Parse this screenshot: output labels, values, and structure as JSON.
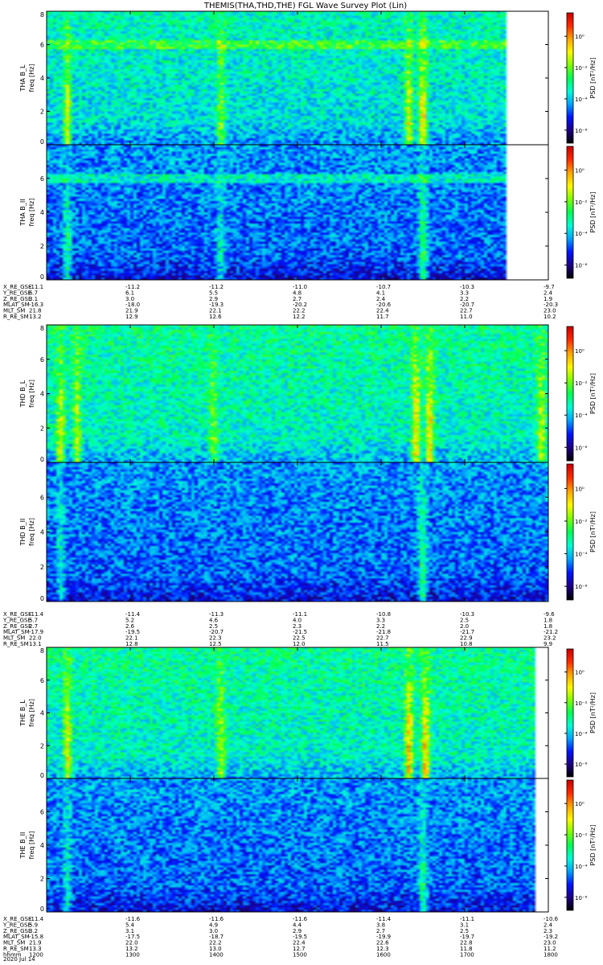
{
  "title": "THEMIS(THA,THD,THE) FGL Wave Survey Plot (Lin)",
  "date_label": "2020 Jul 14",
  "time_row_label": "hhmm",
  "time_ticks": [
    "1200",
    "1300",
    "1400",
    "1500",
    "1600",
    "1700",
    "1800"
  ],
  "chart_data": {
    "type": "heatmap",
    "x": {
      "label": "hhmm",
      "ticks": [
        "1200",
        "1300",
        "1400",
        "1500",
        "1600",
        "1700",
        "1800"
      ],
      "range": [
        "1200",
        "1800"
      ]
    },
    "y": {
      "ticks": [
        "0",
        "2",
        "4",
        "6",
        "8"
      ],
      "range": [
        0,
        8
      ]
    },
    "colorbar": {
      "label": "PSD [nT²/Hz]",
      "ticks": [
        "10⁰",
        "10⁻²",
        "10⁻⁴",
        "10⁻⁶"
      ],
      "colors": [
        "#000000",
        "#1c0086",
        "#0013ff",
        "#00a4ff",
        "#00ffd4",
        "#00ff52",
        "#7fff00",
        "#fff700",
        "#ffa300",
        "#ff2a00",
        "#c80000"
      ]
    },
    "panels": [
      {
        "probe": "THA",
        "component": "B_L",
        "ylabel_probe": "THA B_L",
        "ylabel_unit": "freq [Hz]",
        "data_end_hhmm": "1730",
        "base_level": 0.42,
        "line_freq": 6.0,
        "bursts": [
          {
            "hhmm": "1215",
            "intensity": 0.35
          },
          {
            "hhmm": "1405",
            "intensity": 0.3
          },
          {
            "hhmm": "1620",
            "intensity": 0.4
          },
          {
            "hhmm": "1630",
            "intensity": 0.5
          }
        ]
      },
      {
        "probe": "THA",
        "component": "B_II",
        "ylabel_probe": "THA B_II",
        "ylabel_unit": "freq [Hz]",
        "data_end_hhmm": "1730",
        "base_level": 0.3,
        "line_freq": 6.0,
        "bursts": [
          {
            "hhmm": "1215",
            "intensity": 0.25
          },
          {
            "hhmm": "1405",
            "intensity": 0.2
          },
          {
            "hhmm": "1630",
            "intensity": 0.35
          }
        ]
      },
      {
        "probe": "THD",
        "component": "B_L",
        "ylabel_probe": "THD B_L",
        "ylabel_unit": "freq [Hz]",
        "data_end_hhmm": "1800",
        "base_level": 0.45,
        "line_freq": null,
        "bursts": [
          {
            "hhmm": "1210",
            "intensity": 0.35
          },
          {
            "hhmm": "1222",
            "intensity": 0.3
          },
          {
            "hhmm": "1400",
            "intensity": 0.25
          },
          {
            "hhmm": "1625",
            "intensity": 0.45
          },
          {
            "hhmm": "1635",
            "intensity": 0.45
          },
          {
            "hhmm": "1755",
            "intensity": 0.35
          }
        ]
      },
      {
        "probe": "THD",
        "component": "B_II",
        "ylabel_probe": "THD B_II",
        "ylabel_unit": "freq [Hz]",
        "data_end_hhmm": "1800",
        "base_level": 0.3,
        "line_freq": null,
        "bursts": [
          {
            "hhmm": "1210",
            "intensity": 0.2
          },
          {
            "hhmm": "1630",
            "intensity": 0.35
          }
        ]
      },
      {
        "probe": "THE",
        "component": "B_L",
        "ylabel_probe": "THE B_L",
        "ylabel_unit": "freq [Hz]",
        "data_end_hhmm": "1750",
        "base_level": 0.45,
        "line_freq": null,
        "bursts": [
          {
            "hhmm": "1215",
            "intensity": 0.35
          },
          {
            "hhmm": "1405",
            "intensity": 0.3
          },
          {
            "hhmm": "1620",
            "intensity": 0.45
          },
          {
            "hhmm": "1632",
            "intensity": 0.5
          }
        ]
      },
      {
        "probe": "THE",
        "component": "B_II",
        "ylabel_probe": "THE B_II",
        "ylabel_unit": "freq [Hz]",
        "data_end_hhmm": "1750",
        "base_level": 0.3,
        "line_freq": null,
        "bursts": [
          {
            "hhmm": "1215",
            "intensity": 0.2
          },
          {
            "hhmm": "1630",
            "intensity": 0.3
          }
        ]
      }
    ]
  },
  "ephemeris": [
    {
      "probe": "THA",
      "rows": [
        {
          "label": "X_RE_GSE",
          "values": [
            "-11.1",
            "-11.2",
            "-11.2",
            "-11.0",
            "-10.7",
            "-10.3",
            "-9.7"
          ]
        },
        {
          "label": "Y_RE_GSE",
          "values": [
            "6.7",
            "6.1",
            "5.5",
            "4.8",
            "4.1",
            "3.3",
            "2.4"
          ]
        },
        {
          "label": "Z_RE_GSE",
          "values": [
            "3.1",
            "3.0",
            "2.9",
            "2.7",
            "2.4",
            "2.2",
            "1.9"
          ]
        },
        {
          "label": "MLAT_SM",
          "values": [
            "-16.3",
            "-18.0",
            "-19.3",
            "-20.2",
            "-20.6",
            "-20.7",
            "-20.3"
          ]
        },
        {
          "label": "MLT_SM",
          "values": [
            "21.8",
            "21.9",
            "22.1",
            "22.2",
            "22.4",
            "22.7",
            "23.0"
          ]
        },
        {
          "label": "R_RE_SM",
          "values": [
            "13.2",
            "12.9",
            "12.6",
            "12.2",
            "11.7",
            "11.0",
            "10.2"
          ]
        }
      ]
    },
    {
      "probe": "THD",
      "rows": [
        {
          "label": "X_RE_GSE",
          "values": [
            "-11.4",
            "-11.4",
            "-11.3",
            "-11.1",
            "-10.8",
            "-10.3",
            "-9.6"
          ]
        },
        {
          "label": "Y_RE_GSE",
          "values": [
            "5.7",
            "5.2",
            "4.6",
            "4.0",
            "3.3",
            "2.5",
            "1.8"
          ]
        },
        {
          "label": "Z_RE_GSE",
          "values": [
            "2.7",
            "2.6",
            "2.5",
            "2.3",
            "2.2",
            "2.0",
            "1.8"
          ]
        },
        {
          "label": "MLAT_SM",
          "values": [
            "-17.9",
            "-19.5",
            "-20.7",
            "-21.5",
            "-21.8",
            "-21.7",
            "-21.2"
          ]
        },
        {
          "label": "MLT_SM",
          "values": [
            "22.0",
            "22.1",
            "22.3",
            "22.5",
            "22.7",
            "22.9",
            "23.2"
          ]
        },
        {
          "label": "R_RE_SM",
          "values": [
            "13.1",
            "12.8",
            "12.5",
            "12.0",
            "11.5",
            "10.8",
            "9.9"
          ]
        }
      ]
    },
    {
      "probe": "THE",
      "rows": [
        {
          "label": "X_RE_GSE",
          "values": [
            "-11.4",
            "-11.6",
            "-11.6",
            "-11.6",
            "-11.4",
            "-11.1",
            "-10.6"
          ]
        },
        {
          "label": "Y_RE_GSE",
          "values": [
            "5.9",
            "5.4",
            "4.9",
            "4.4",
            "3.8",
            "3.1",
            "2.4"
          ]
        },
        {
          "label": "Z_RE_GSE",
          "values": [
            "3.2",
            "3.1",
            "3.0",
            "2.9",
            "2.7",
            "2.5",
            "2.3"
          ]
        },
        {
          "label": "MLAT_SM",
          "values": [
            "-15.8",
            "-17.5",
            "-18.7",
            "-19.5",
            "-19.9",
            "-19.7",
            "-19.2"
          ]
        },
        {
          "label": "MLT_SM",
          "values": [
            "21.9",
            "22.0",
            "22.2",
            "22.4",
            "22.6",
            "22.8",
            "23.0"
          ]
        },
        {
          "label": "R_RE_SM",
          "values": [
            "13.3",
            "13.2",
            "13.0",
            "12.7",
            "12.3",
            "11.8",
            "11.2"
          ]
        }
      ]
    }
  ]
}
